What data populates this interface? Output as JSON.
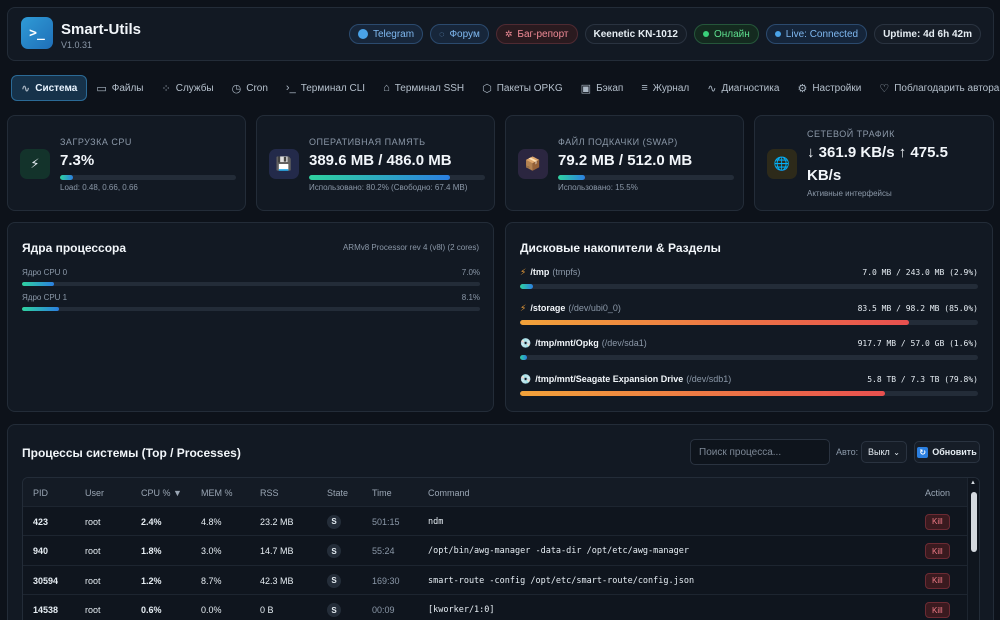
{
  "app": {
    "title": "Smart-Utils",
    "version": "V1.0.31",
    "logo_glyph": ">_"
  },
  "header_pills": {
    "telegram": "Telegram",
    "forum": "Форум",
    "bug": "Баг-репорт",
    "model": "Keenetic KN-1012",
    "online": "Онлайн",
    "live": "Live: Connected",
    "uptime": "Uptime: 4d 6h 42m"
  },
  "nav": [
    {
      "label": "Система",
      "icon": "∿",
      "active": true
    },
    {
      "label": "Файлы",
      "icon": "▭"
    },
    {
      "label": "Службы",
      "icon": "⁘"
    },
    {
      "label": "Cron",
      "icon": "◷"
    },
    {
      "label": "Терминал CLI",
      "icon": "›_"
    },
    {
      "label": "Терминал SSH",
      "icon": "⌂"
    },
    {
      "label": "Пакеты OPKG",
      "icon": "⬡"
    },
    {
      "label": "Бэкап",
      "icon": "▣"
    },
    {
      "label": "Журнал",
      "icon": "≡"
    },
    {
      "label": "Диагностика",
      "icon": "∿"
    },
    {
      "label": "Настройки",
      "icon": "⚙"
    },
    {
      "label": "Поблагодарить автора",
      "icon": "♡"
    }
  ],
  "stats": {
    "cpu": {
      "label": "ЗАГРУЗКА CPU",
      "value": "7.3%",
      "percent": 7.3,
      "sub": "Load: 0.48, 0.66, 0.66",
      "icon": "⚡"
    },
    "ram": {
      "label": "ОПЕРАТИВНАЯ ПАМЯТЬ",
      "value": "389.6 MB / 486.0 MB",
      "percent": 80.2,
      "sub": "Использовано: 80.2% (Свободно: 67.4 MB)",
      "icon": "💾"
    },
    "swap": {
      "label": "ФАЙЛ ПОДКАЧКИ (SWAP)",
      "value": "79.2 MB / 512.0 MB",
      "percent": 15.5,
      "sub": "Использовано: 15.5%",
      "icon": "📦"
    },
    "net": {
      "label": "СЕТЕВОЙ ТРАФИК",
      "value_line1": "↓ 361.9 KB/s ↑ 475.5",
      "value_line2": "KB/s",
      "sub": "Активные интерфейсы",
      "icon": "🌐"
    }
  },
  "cores": {
    "title": "Ядра процессора",
    "meta": "ARMv8 Processor rev 4 (v8l) (2 cores)",
    "items": [
      {
        "label": "Ядро CPU 0",
        "value": "7.0%",
        "percent": 7.0
      },
      {
        "label": "Ядро CPU 1",
        "value": "8.1%",
        "percent": 8.1
      }
    ]
  },
  "disks": {
    "title": "Дисковые накопители & Разделы",
    "items": [
      {
        "icon": "⚡",
        "mount": "/tmp",
        "dev": "(tmpfs)",
        "value": "7.0 MB / 243.0 MB (2.9%)",
        "percent": 2.9,
        "warn": false
      },
      {
        "icon": "⚡",
        "mount": "/storage",
        "dev": "(/dev/ubi0_0)",
        "value": "83.5 MB / 98.2 MB (85.0%)",
        "percent": 85.0,
        "warn": true
      },
      {
        "icon": "💿",
        "mount": "/tmp/mnt/Opkg",
        "dev": "(/dev/sda1)",
        "value": "917.7 MB / 57.0 GB (1.6%)",
        "percent": 1.6,
        "warn": false
      },
      {
        "icon": "💿",
        "mount": "/tmp/mnt/Seagate Expansion Drive",
        "dev": "(/dev/sdb1)",
        "value": "5.8 TB / 7.3 TB (79.8%)",
        "percent": 79.8,
        "warn": true
      }
    ]
  },
  "processes": {
    "title": "Процессы системы (Top / Processes)",
    "search_placeholder": "Поиск процесса...",
    "auto_label": "Авто:",
    "auto_value": "Выкл",
    "refresh_label": "Обновить",
    "columns": [
      "PID",
      "User",
      "CPU % ▼",
      "MEM %",
      "RSS",
      "State",
      "Time",
      "Command",
      "Action"
    ],
    "kill_label": "Kill",
    "rows": [
      {
        "pid": "423",
        "user": "root",
        "cpu": "2.4%",
        "mem": "4.8%",
        "rss": "23.2 MB",
        "state": "S",
        "time": "501:15",
        "cmd": "ndm"
      },
      {
        "pid": "940",
        "user": "root",
        "cpu": "1.8%",
        "mem": "3.0%",
        "rss": "14.7 MB",
        "state": "S",
        "time": "55:24",
        "cmd": "/opt/bin/awg-manager -data-dir /opt/etc/awg-manager"
      },
      {
        "pid": "30594",
        "user": "root",
        "cpu": "1.2%",
        "mem": "8.7%",
        "rss": "42.3 MB",
        "state": "S",
        "time": "169:30",
        "cmd": "smart-route -config /opt/etc/smart-route/config.json"
      },
      {
        "pid": "14538",
        "user": "root",
        "cpu": "0.6%",
        "mem": "0.0%",
        "rss": "0 B",
        "state": "S",
        "time": "00:09",
        "cmd": "[kworker/1:0]"
      }
    ]
  }
}
